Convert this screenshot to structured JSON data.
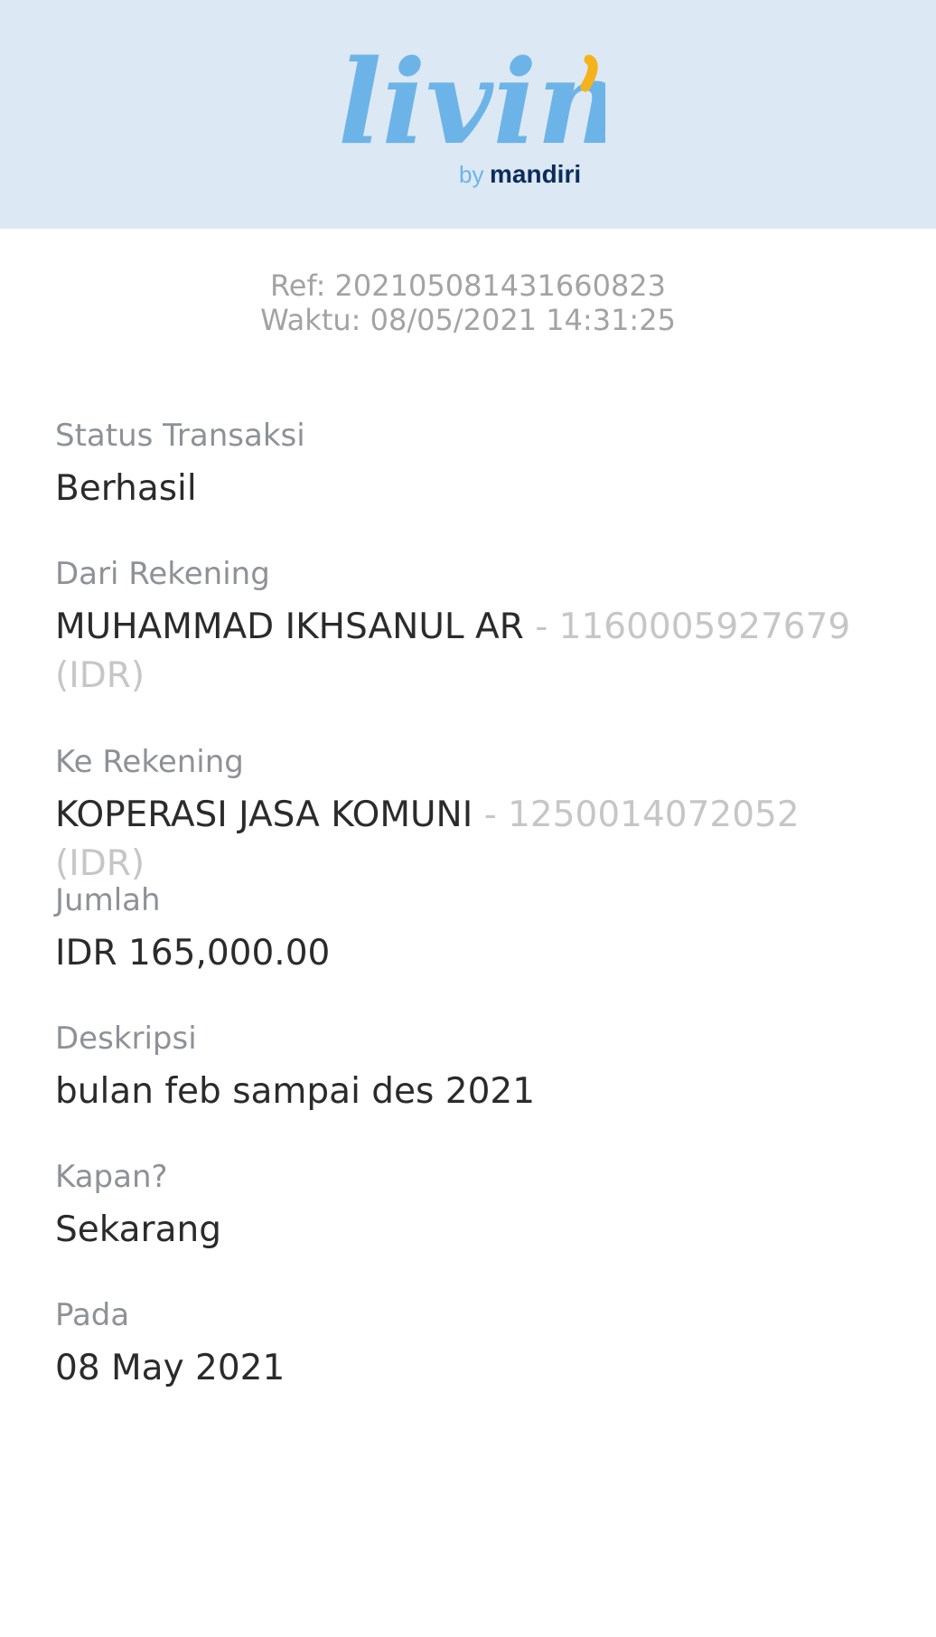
{
  "header": {
    "logo_text": "livin'",
    "logo_sub_by": "by",
    "logo_sub_brand": "mandiri",
    "colors": {
      "background": "#dce8f3",
      "logo_blue": "#6cb4e8",
      "logo_yellow": "#f5b21b",
      "brand_navy": "#0d2c5c"
    }
  },
  "meta": {
    "ref": "Ref: 202105081431660823",
    "time": "Waktu: 08/05/2021 14:31:25"
  },
  "fields": {
    "status": {
      "label": "Status Transaksi",
      "value": "Berhasil"
    },
    "from_account": {
      "label": "Dari Rekening",
      "name": "MUHAMMAD IKHSANUL AR",
      "account": " - 1160005927679 (IDR)"
    },
    "to_account": {
      "label": "Ke Rekening",
      "name": "KOPERASI JASA KOMUNI",
      "account": " - 1250014072052 (IDR)"
    },
    "amount": {
      "label": "Jumlah",
      "value": "IDR 165,000.00"
    },
    "description": {
      "label": "Deskripsi",
      "value": "bulan feb sampai des 2021"
    },
    "when": {
      "label": "Kapan?",
      "value": "Sekarang"
    },
    "date": {
      "label": "Pada",
      "value": "08 May 2021"
    }
  }
}
